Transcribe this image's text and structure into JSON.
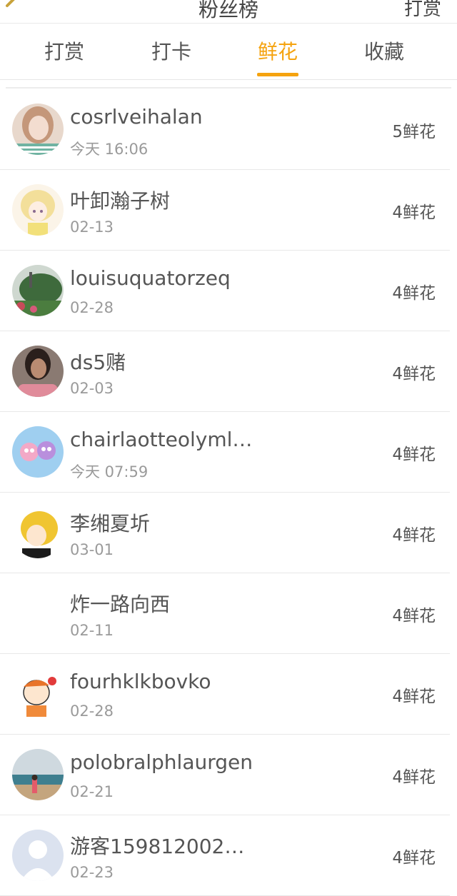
{
  "header": {
    "title": "粉丝榜",
    "right_label": "打赏"
  },
  "tabs": [
    {
      "label": "打赏",
      "active": false
    },
    {
      "label": "打卡",
      "active": false
    },
    {
      "label": "鲜花",
      "active": true
    },
    {
      "label": "收藏",
      "active": false
    }
  ],
  "accent_color": "#f5a30f",
  "rows": [
    {
      "name": "cosrlveihalan",
      "date": "今天 16:06",
      "count": "5鲜花",
      "avatar": "photo-girl-avatar"
    },
    {
      "name": "叶卸瀚子树",
      "date": "02-13",
      "count": "4鲜花",
      "avatar": "anime-girl-avatar"
    },
    {
      "name": "louisuquatorzeq",
      "date": "02-28",
      "count": "4鲜花",
      "avatar": "garden-avatar"
    },
    {
      "name": "ds5赌",
      "date": "02-03",
      "count": "4鲜花",
      "avatar": "photo-woman-avatar"
    },
    {
      "name": "chairlaotteolyml…",
      "date": "今天 07:59",
      "count": "4鲜花",
      "avatar": "cartoon-pigs-avatar"
    },
    {
      "name": "李缃夏圻",
      "date": "03-01",
      "count": "4鲜花",
      "avatar": "anime-blonde-avatar"
    },
    {
      "name": "炸一路向西",
      "date": "02-11",
      "count": "4鲜花",
      "avatar": "blank-avatar"
    },
    {
      "name": "fourhklkbovko",
      "date": "02-28",
      "count": "4鲜花",
      "avatar": "cartoon-character-avatar"
    },
    {
      "name": "polobralphlaurgen",
      "date": "02-21",
      "count": "4鲜花",
      "avatar": "beach-avatar"
    },
    {
      "name": "游客159812002…",
      "date": "02-23",
      "count": "4鲜花",
      "avatar": "default-user-avatar"
    }
  ]
}
